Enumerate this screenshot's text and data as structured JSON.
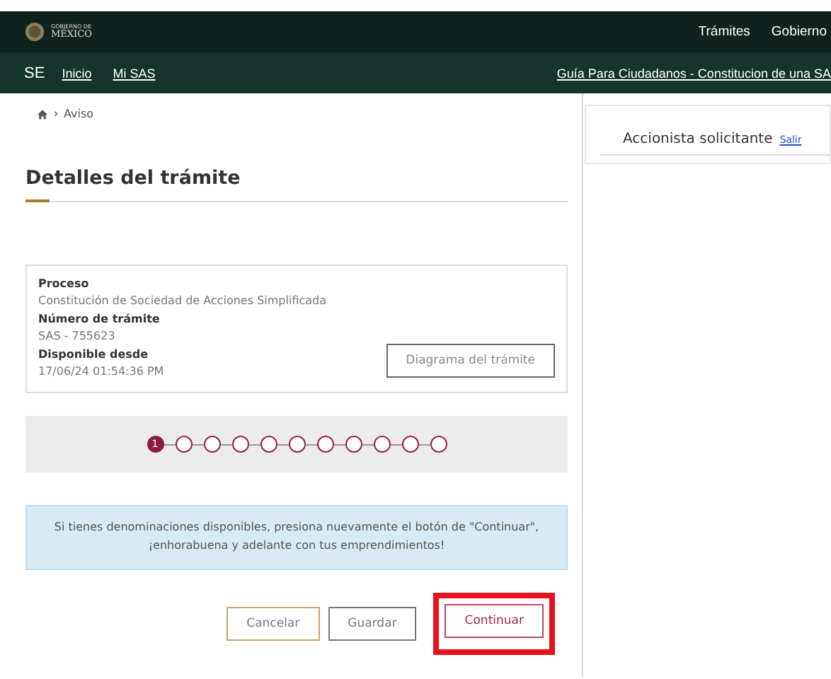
{
  "header": {
    "logo_top": "GOBIERNO DE",
    "logo_bottom": "MÉXICO",
    "links": [
      "Trámites",
      "Gobierno"
    ]
  },
  "subnav": {
    "brand": "SE",
    "links": [
      "Inicio",
      "Mi SAS"
    ],
    "guide_link": "Guía Para Ciudadanos - Constitucion de una SA"
  },
  "breadcrumb": [
    "Aviso"
  ],
  "title": "Detalles del trámite",
  "details": [
    {
      "label": "Proceso",
      "value": "Constitución de Sociedad de Acciones Simplificada"
    },
    {
      "label": "Número de trámite",
      "value": "SAS - 755623"
    },
    {
      "label": "Disponible desde",
      "value": "17/06/24 01:54:36 PM"
    }
  ],
  "diagram_button": "Diagrama del trámite",
  "steps": [
    {
      "label": "1",
      "selected": true
    },
    {
      "selected": false
    },
    {
      "selected": false
    },
    {
      "selected": false
    },
    {
      "selected": false
    },
    {
      "selected": false
    },
    {
      "selected": false
    },
    {
      "selected": false
    },
    {
      "selected": false
    },
    {
      "selected": false
    },
    {
      "selected": false
    }
  ],
  "notice": "Si tienes denominaciones disponibles, presiona nuevamente el botón de \"Continuar\", ¡enhorabuena y adelante con tus emprendimientos!",
  "buttons": [
    {
      "label": "Cancelar",
      "kind": "cancel",
      "highlighted": false
    },
    {
      "label": "Guardar",
      "kind": "save",
      "highlighted": false
    },
    {
      "label": "Continuar",
      "kind": "continue",
      "highlighted": true
    }
  ],
  "user_panel": {
    "role": "Accionista solicitante",
    "logout": "Salir"
  }
}
